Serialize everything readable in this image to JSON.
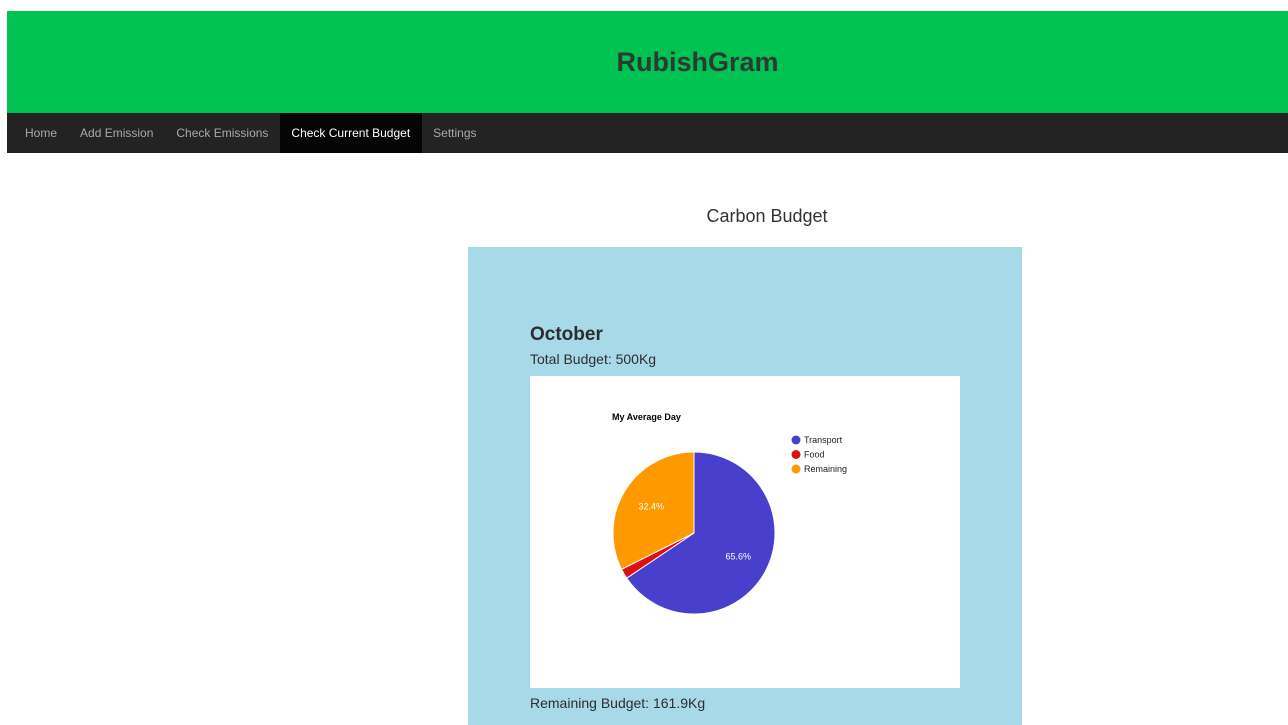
{
  "app": {
    "title": "RubishGram"
  },
  "nav": {
    "items": [
      {
        "label": "Home",
        "name": "nav-home",
        "active": false
      },
      {
        "label": "Add Emission",
        "name": "nav-add-emission",
        "active": false
      },
      {
        "label": "Check Emissions",
        "name": "nav-check-emissions",
        "active": false
      },
      {
        "label": "Check Current Budget",
        "name": "nav-check-current-budget",
        "active": true
      },
      {
        "label": "Settings",
        "name": "nav-settings",
        "active": false
      }
    ]
  },
  "page": {
    "title": "Carbon Budget"
  },
  "budget": {
    "month": "October",
    "total_label": "Total Budget: 500Kg",
    "remaining_label": "Remaining Budget: 161.9Kg"
  },
  "colors": {
    "header_bg": "#00c250",
    "nav_bg": "#232323",
    "panel_bg": "#a8d9e8",
    "transport": "#4840cc",
    "food": "#dc1010",
    "remaining": "#ff9900"
  },
  "chart_data": {
    "type": "pie",
    "title": "My Average Day",
    "legend_position": "right",
    "categories": [
      "Transport",
      "Food",
      "Remaining"
    ],
    "values": [
      65.6,
      2.0,
      32.4
    ],
    "data_labels": [
      "65.6%",
      "",
      "32.4%"
    ],
    "colors": [
      "#4840cc",
      "#dc1010",
      "#ff9900"
    ]
  }
}
